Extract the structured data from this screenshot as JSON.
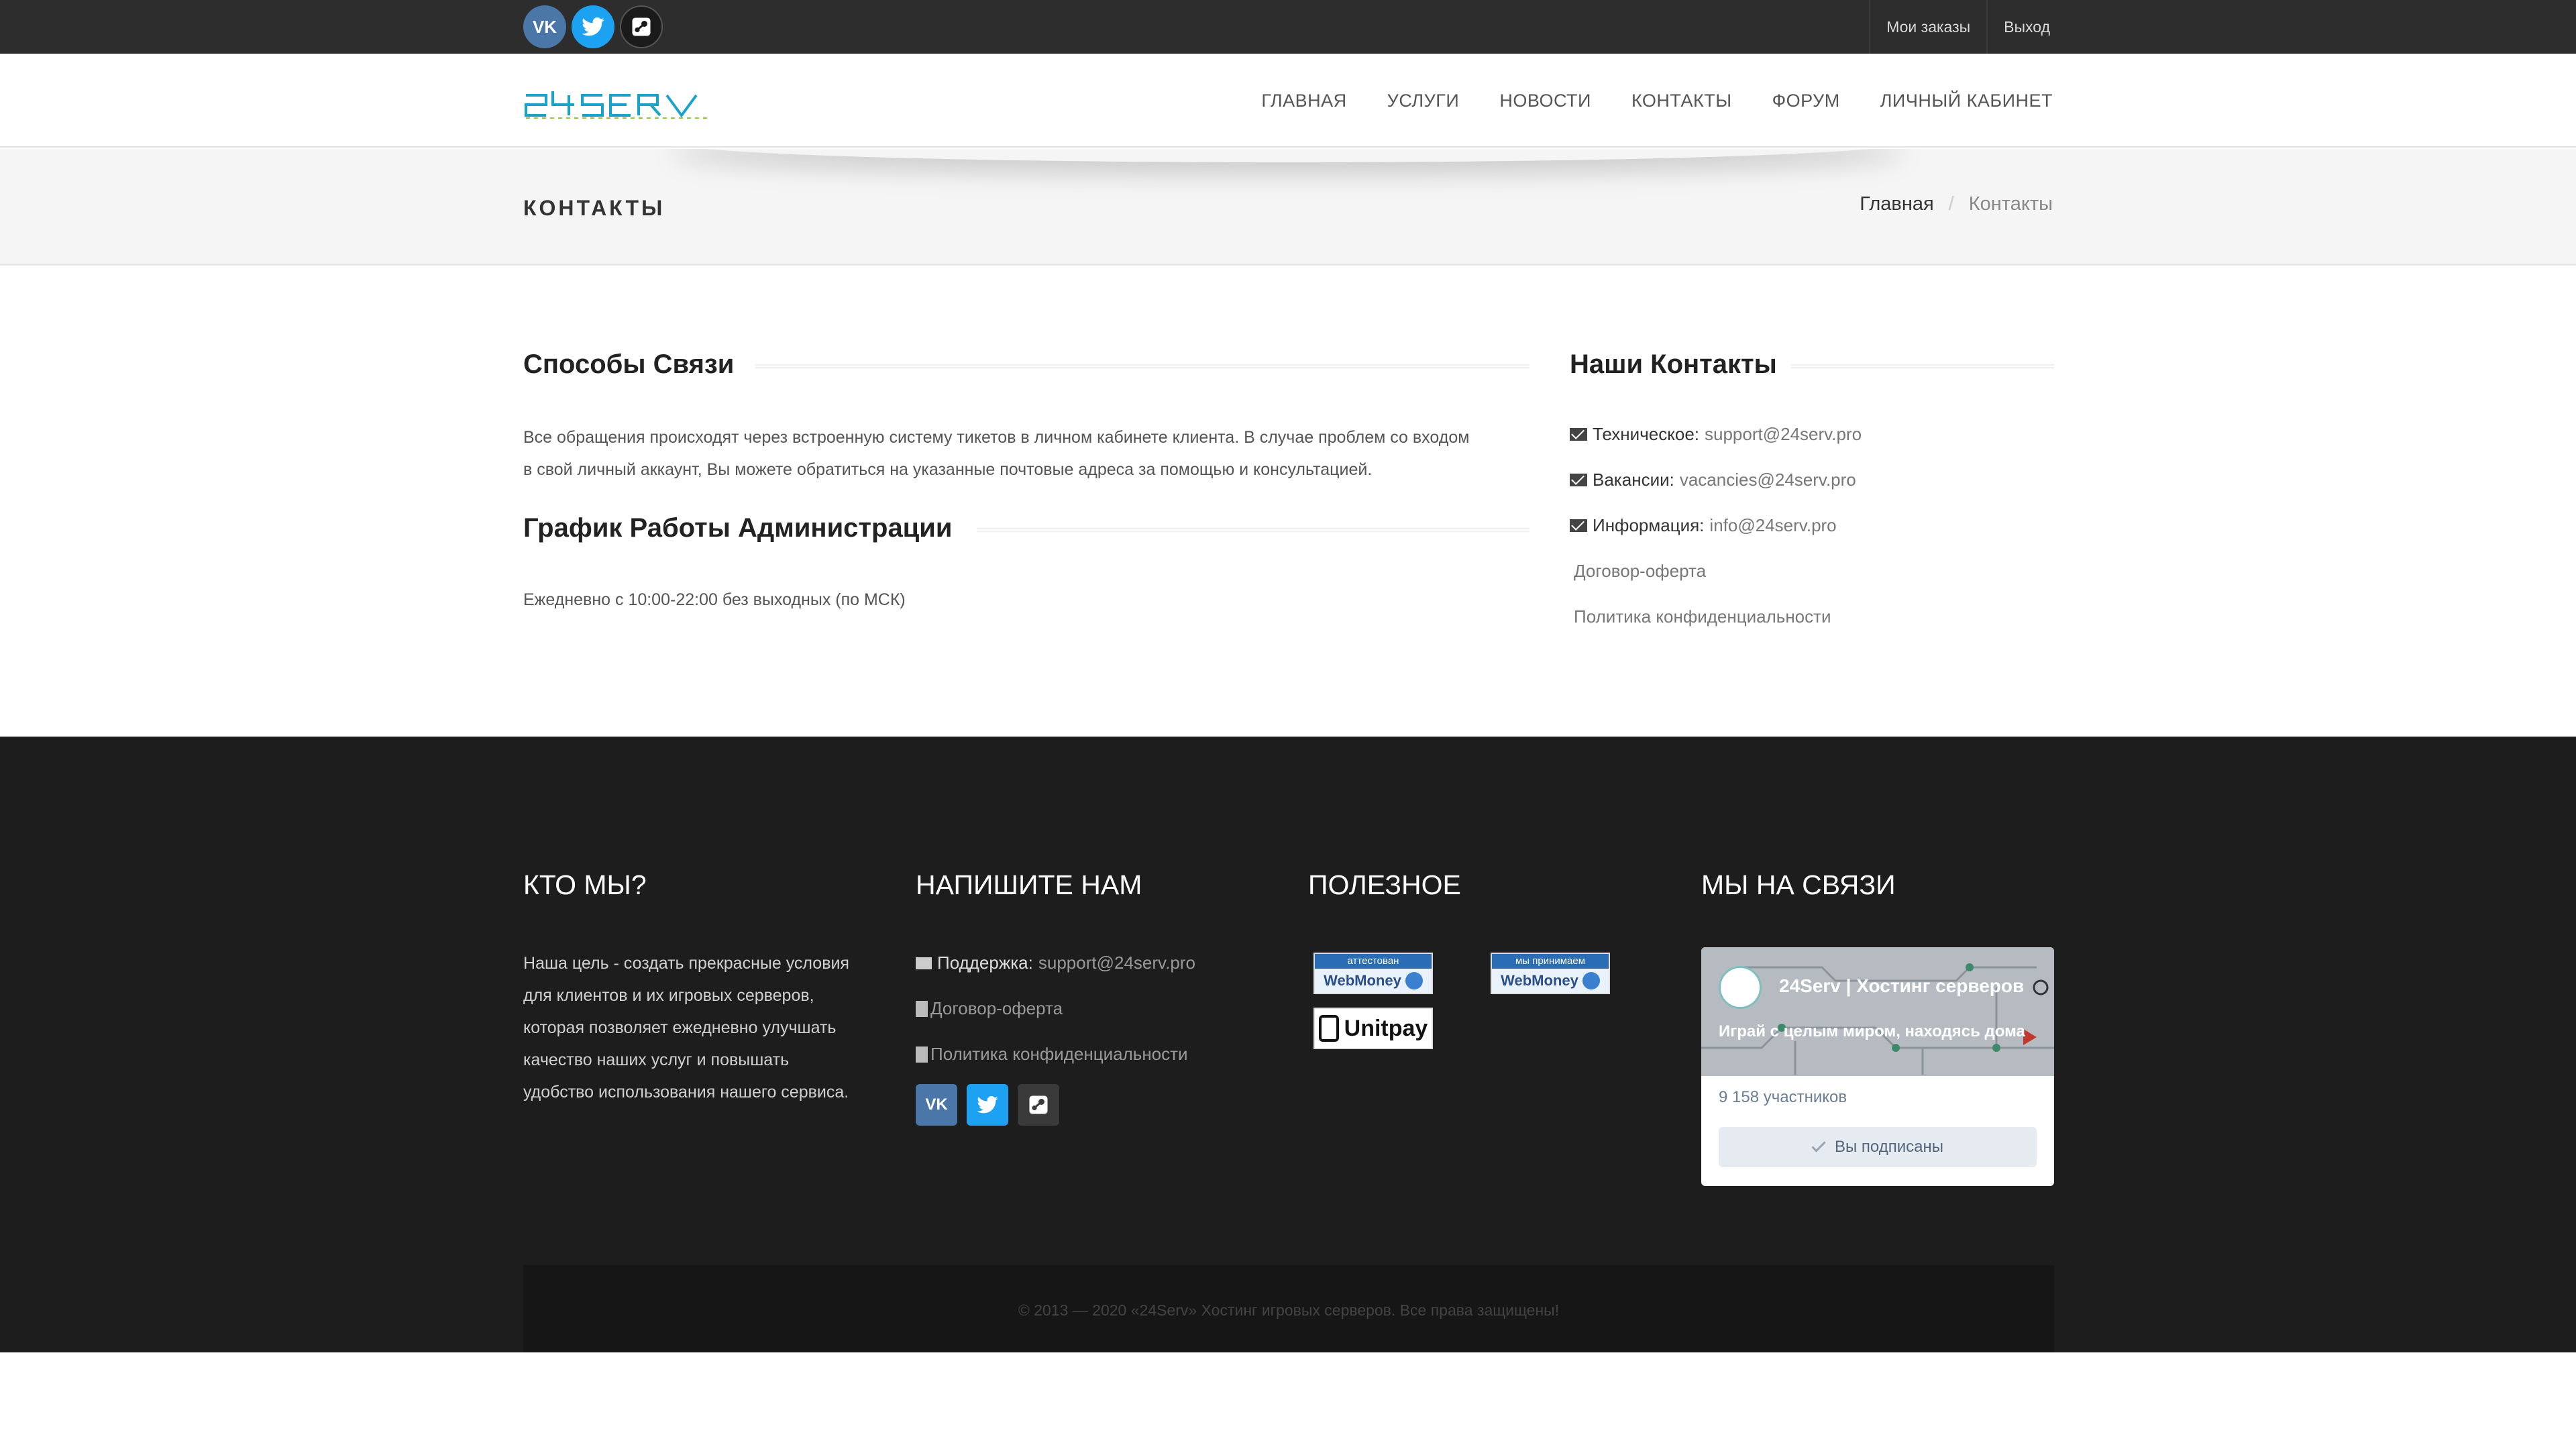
{
  "topbar": {
    "social": [
      {
        "icon": "vk-icon",
        "glyph": "VK"
      },
      {
        "icon": "twitter-icon",
        "glyph": "t"
      },
      {
        "icon": "steam-icon",
        "glyph": "S"
      }
    ],
    "links": [
      "Мои заказы",
      "Выход"
    ]
  },
  "header": {
    "logo_text": "24SERV",
    "nav": [
      "ГЛАВНАЯ",
      "УСЛУГИ",
      "НОВОСТИ",
      "КОНТАКТЫ",
      "ФОРУМ",
      "ЛИЧНЫЙ КАБИНЕТ"
    ]
  },
  "page": {
    "title": "КОНТАКТЫ",
    "breadcrumb": {
      "home": "Главная",
      "separator": "/",
      "current": "Контакты"
    }
  },
  "main": {
    "ways_title": "Способы Связи",
    "ways_text_1": "Все обращения происходят через встроенную систему тикетов в личном кабинете клиента. В случае проблем со входом",
    "ways_text_2": "в свой личный аккаунт, Вы можете обратиться на указанные почтовые адреса за помощью и консультацией.",
    "schedule_title": "График Работы Администрации",
    "schedule_text": "Ежедневно с 10:00-22:00 без выходных (по МСК)",
    "contacts_title": "Наши Контакты",
    "contacts": [
      {
        "label": "Техническое:",
        "value": "support@24serv.pro"
      },
      {
        "label": "Вакансии:",
        "value": "vacancies@24serv.pro"
      },
      {
        "label": "Информация:",
        "value": "info@24serv.pro"
      }
    ],
    "offer_link": "Договор-оферта",
    "privacy_link": "Политика конфиденциальности"
  },
  "footer": {
    "about_title": "КТО МЫ?",
    "about_lines": [
      "Наша цель - создать прекрасные условия",
      "для клиентов и их игровых серверов,",
      "которая позволяет ежедневно улучшать",
      "качество наших услуг и повышать",
      "удобство использования нашего сервиса."
    ],
    "write_title": "НАПИШИТЕ НАМ",
    "support_label": "Поддержка:",
    "support_value": "support@24serv.pro",
    "offer_link": "Договор-оферта",
    "privacy_link": "Политика конфиденциальности",
    "useful_title": "ПОЛЕЗНОЕ",
    "badges": {
      "wm1_top": "аттестован",
      "wm2_top": "мы принимаем",
      "wm_name": "WebMoney",
      "unitpay": "Unitpay"
    },
    "connect_title": "МЫ НА СВЯЗИ",
    "vk_widget": {
      "group_name": "24Serv | Хостинг серверов",
      "slogan": "Играй с целым миром, находясь дома",
      "members": "9 158 участников",
      "button": "Вы подписаны"
    },
    "copyright": "© 2013 — 2020 «24Serv» Хостинг игровых серверов. Все права защищены!"
  },
  "colors": {
    "topbar": "#2d2d2d",
    "footer": "#1d1d1d",
    "logo": "#1aa3c9",
    "vk": "#4a76a8",
    "twitter": "#1da1f2"
  }
}
